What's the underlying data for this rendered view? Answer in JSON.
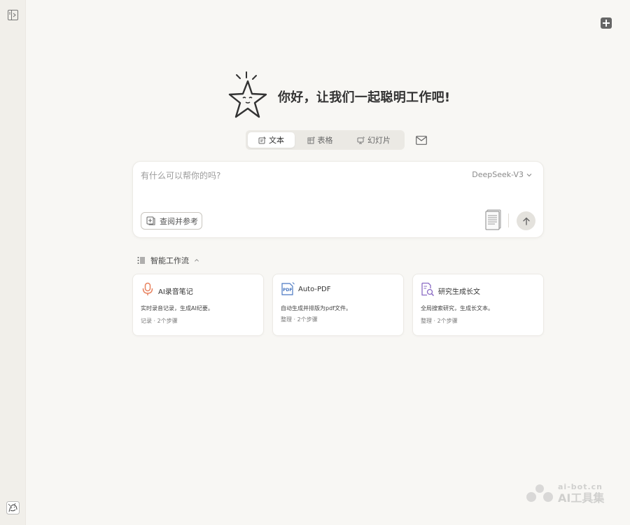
{
  "header": {
    "greeting": "你好，让我们一起聪明工作吧!"
  },
  "mode_tabs": [
    {
      "label": "文本",
      "icon": "text-edit-icon",
      "active": true
    },
    {
      "label": "表格",
      "icon": "table-icon",
      "active": false
    },
    {
      "label": "幻灯片",
      "icon": "slides-icon",
      "active": false
    }
  ],
  "composer": {
    "placeholder": "有什么可以帮你的吗?",
    "model": "DeepSeek-V3",
    "reference_button": "查阅并参考"
  },
  "workflows": {
    "title": "智能工作流",
    "cards": [
      {
        "title": "AI录音笔记",
        "description": "实时录音记录，生成AI纪要。",
        "category": "记录",
        "steps": "2个步骤",
        "icon": "microphone-icon",
        "accent": "#e8825f"
      },
      {
        "title": "Auto-PDF",
        "description": "自动生成并排版为pdf文件。",
        "category": "整理",
        "steps": "2个步骤",
        "icon": "pdf-icon",
        "accent": "#4a78c2"
      },
      {
        "title": "研究生成长文",
        "description": "全局搜索研究，生成长文本。",
        "category": "整理",
        "steps": "2个步骤",
        "icon": "doc-search-icon",
        "accent": "#8a6bc4"
      }
    ]
  },
  "watermark": {
    "url": "ai-bot.cn",
    "name": "AI工具集"
  },
  "colors": {
    "background": "#f8f7f4",
    "sidebar": "#f1efea",
    "card": "#ffffff"
  }
}
